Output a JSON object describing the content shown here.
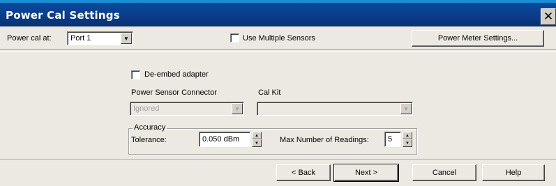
{
  "window": {
    "title": "Power Cal Settings",
    "close_glyph": "✕"
  },
  "top_row": {
    "power_cal_label": "Power cal at:",
    "port_value": "Port 1",
    "use_multiple_sensors_label": "Use Multiple Sensors",
    "use_multiple_sensors_checked": false,
    "power_meter_settings_label": "Power Meter Settings..."
  },
  "adapter": {
    "de_embed_label": "De-embed adapter",
    "de_embed_checked": false
  },
  "connector": {
    "power_sensor_connector_label": "Power Sensor Connector",
    "power_sensor_connector_value": "Ignored",
    "cal_kit_label": "Cal Kit",
    "cal_kit_value": ""
  },
  "accuracy": {
    "group_title": "Accuracy",
    "tolerance_label": "Tolerance:",
    "tolerance_value": "0.050 dBm",
    "max_readings_label": "Max Number of Readings:",
    "max_readings_value": "5"
  },
  "buttons": {
    "back": "< Back",
    "next": "Next >",
    "cancel": "Cancel",
    "help": "Help"
  },
  "icons": {
    "dropdown": "chevron-down-icon",
    "spin_up": "arrow-up-icon",
    "spin_down": "arrow-down-icon"
  }
}
